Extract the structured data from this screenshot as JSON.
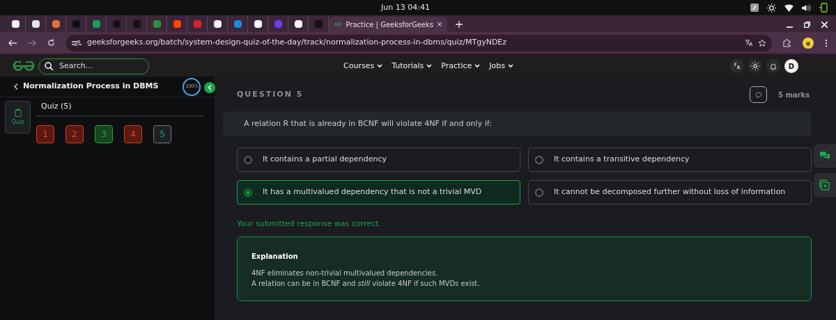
{
  "system_bar": {
    "clock": "Jun 13  04:41"
  },
  "browser": {
    "pinned_tabs": [
      {
        "color": "#ffffff"
      },
      {
        "color": "#e5e5e5"
      },
      {
        "color": "#e0703a"
      },
      {
        "color": "#111111"
      },
      {
        "color": "#1f9d55"
      },
      {
        "color": "#111111"
      },
      {
        "color": "#111111"
      },
      {
        "color": "#2f8d46"
      },
      {
        "color": "#ff4500"
      },
      {
        "color": "#e0202a"
      },
      {
        "color": "#f5f5f5"
      },
      {
        "color": "#1e88e5"
      },
      {
        "color": "#ffffff"
      },
      {
        "color": "#6a3df0"
      },
      {
        "color": "#f5f5f5"
      },
      {
        "color": "#111111"
      }
    ],
    "active_tab": {
      "title": "Practice | GeeksforGeeks"
    },
    "url": "geeksforgeeks.org/batch/system-design-quiz-of-the-day/track/normalization-process-in-dbms/quiz/MTgyNDEz"
  },
  "header": {
    "search": {
      "placeholder": "Search..."
    },
    "nav": [
      "Courses",
      "Tutorials",
      "Practice",
      "Jobs"
    ],
    "avatar": "D"
  },
  "sidebar": {
    "title": "Normalization Process in DBMS",
    "progress": "100%",
    "rail": [
      {
        "label": "Quiz",
        "selected": true
      }
    ],
    "section": "Quiz (5)",
    "questions": [
      {
        "number": "1",
        "kind": "wrong",
        "selected": false
      },
      {
        "number": "2",
        "kind": "wrong",
        "selected": false
      },
      {
        "number": "3",
        "kind": "correct",
        "selected": false
      },
      {
        "number": "4",
        "kind": "wrong",
        "selected": false
      },
      {
        "number": "5",
        "kind": "correct",
        "selected": true
      }
    ]
  },
  "question": {
    "label": "QUESTION 5",
    "marks": "5 marks",
    "text": "A relation R that is already in BCNF will violate 4NF if and only if:",
    "options": [
      {
        "text": "It contains a partial dependency",
        "selected": false
      },
      {
        "text": "It contains a transitive dependency",
        "selected": false
      },
      {
        "text": "It has a multivalued dependency that is not a trivial MVD",
        "selected": true
      },
      {
        "text": "It cannot be decomposed further without loss of information",
        "selected": false
      }
    ],
    "feedback": "Your submitted response was correct.",
    "explanation": {
      "title": "Explanation",
      "lines": [
        "4NF eliminates non-trivial multivalued dependencies.",
        "A relation can be in BCNF and *still* violate 4NF if such MVDs exist."
      ]
    }
  }
}
